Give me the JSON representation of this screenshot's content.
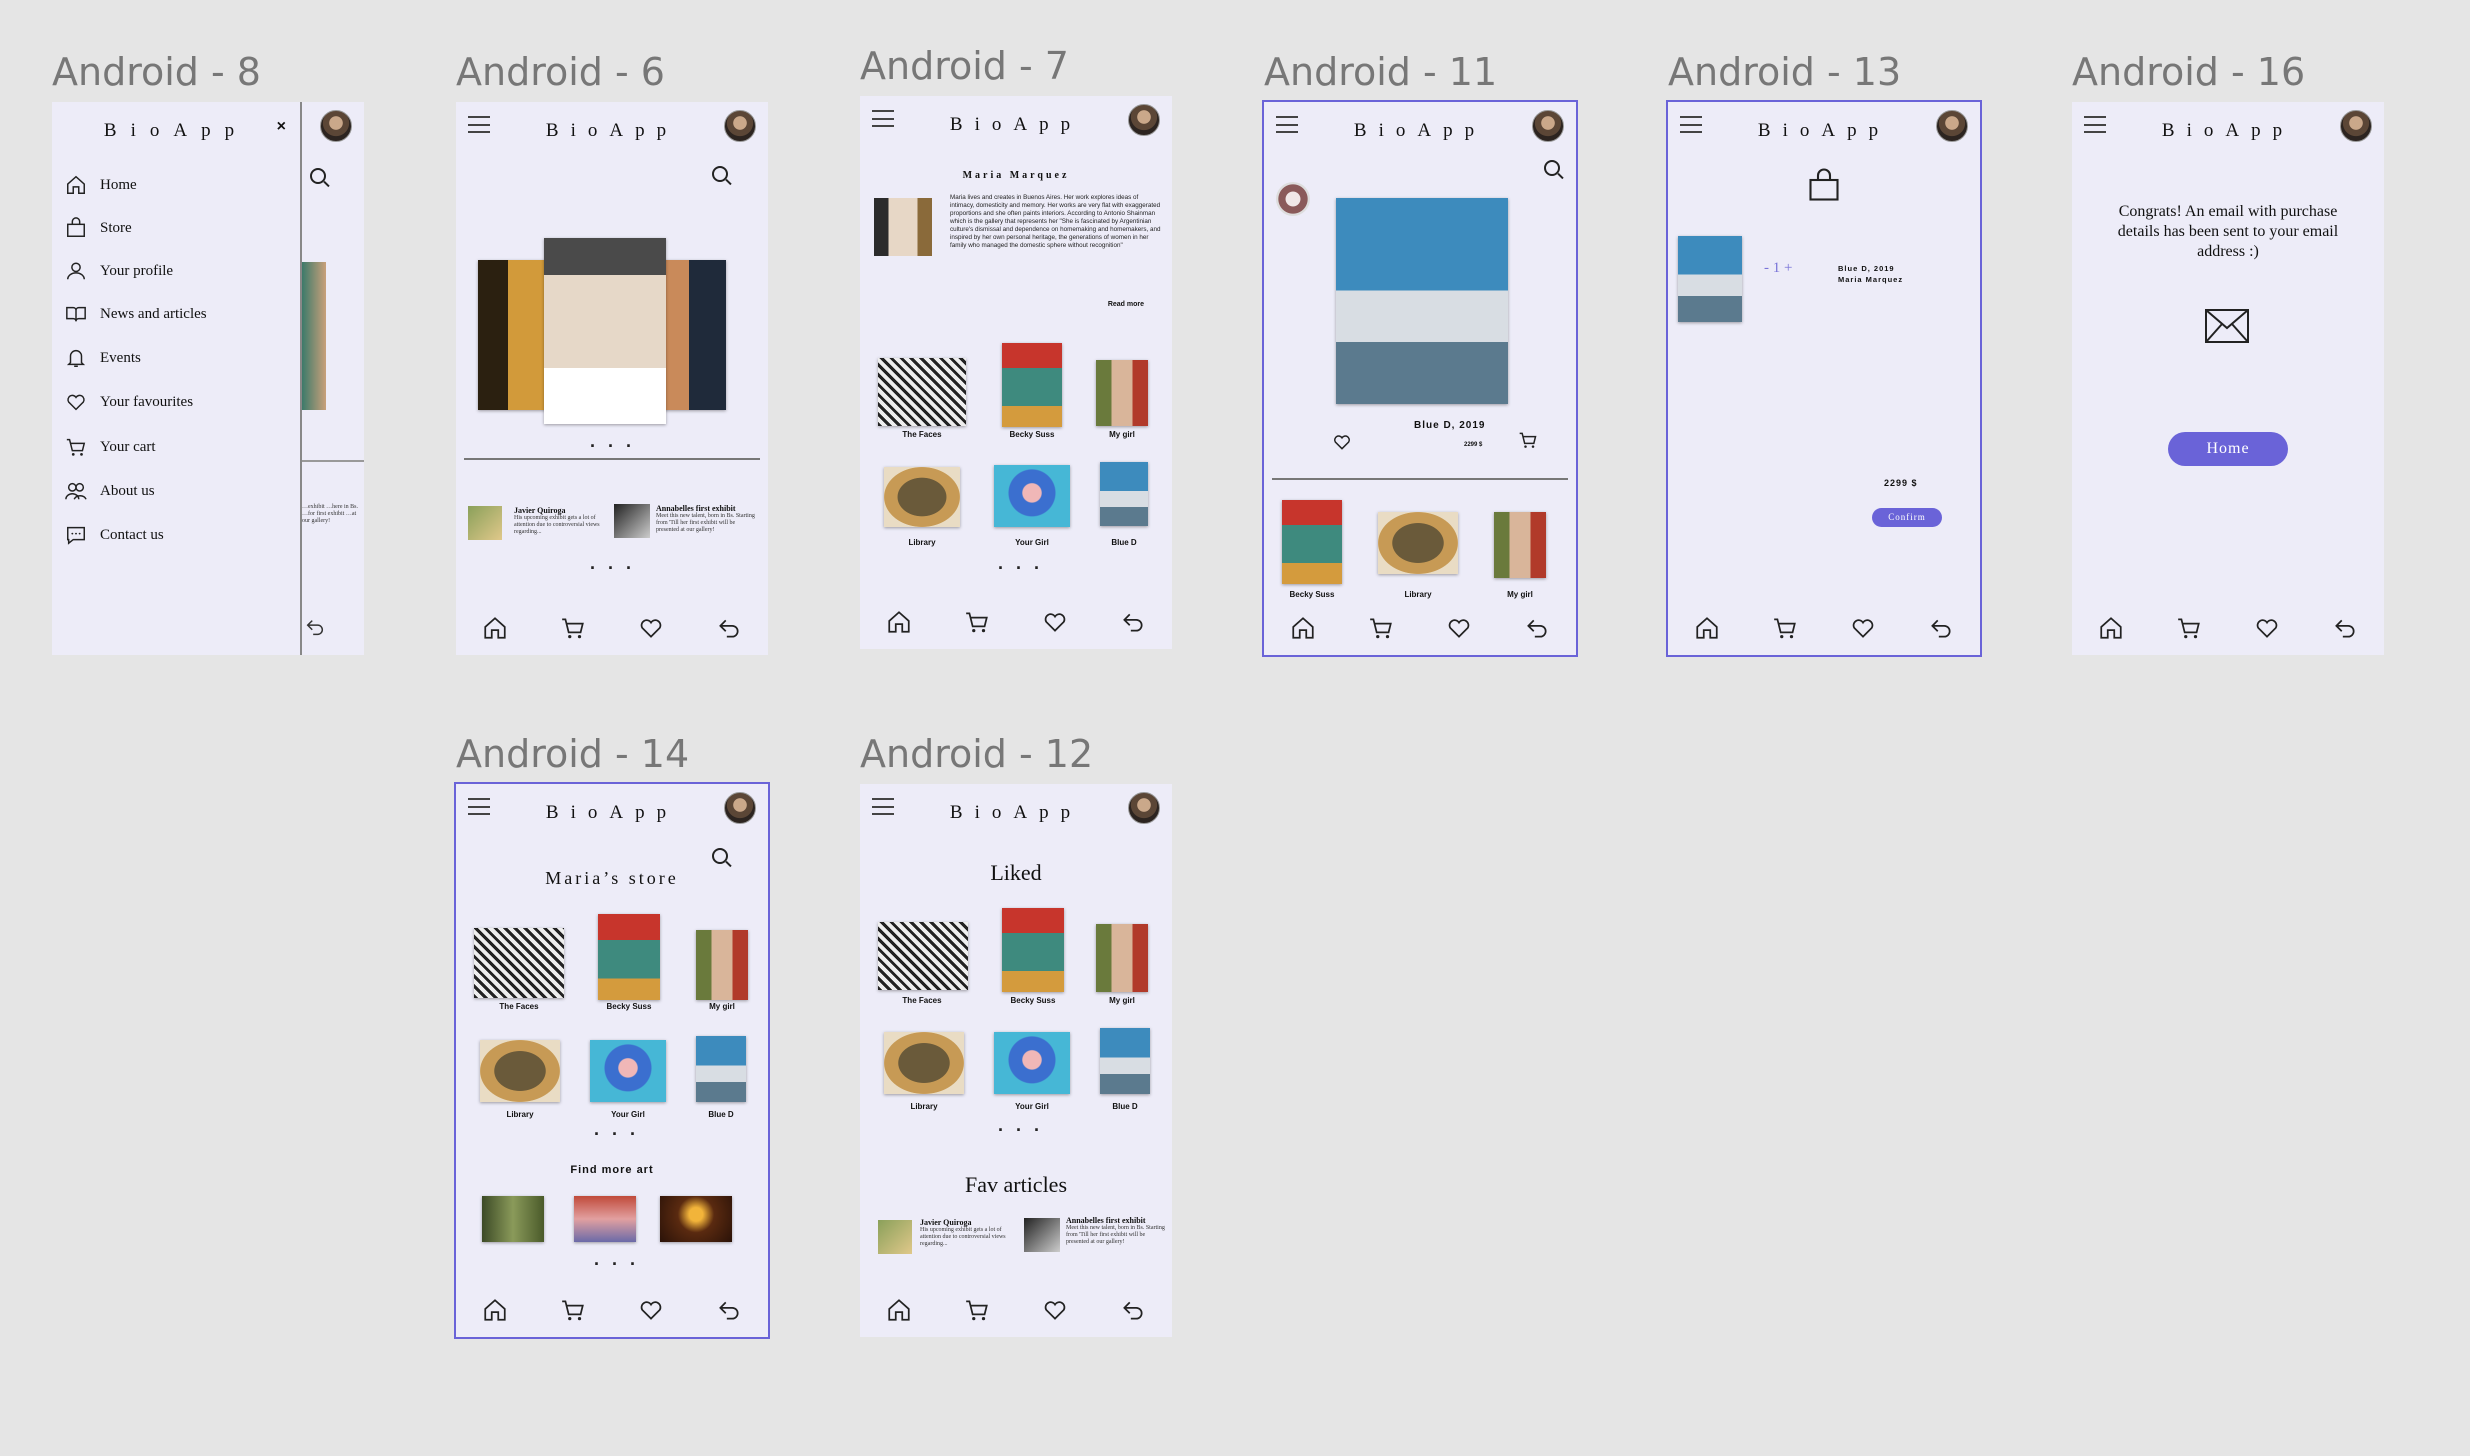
{
  "colors": {
    "canvas": "#e5e5e5",
    "frame_bg": "#edecf8",
    "accent": "#6a63d8",
    "selection": "#6a63d8"
  },
  "app": {
    "logo": "BioApp"
  },
  "frames": {
    "a8": {
      "label": "Android - 8",
      "close": "×",
      "menu": [
        "Home",
        "Store",
        "Your profile",
        "News and articles",
        "Events",
        "Your favourites",
        "Your cart",
        "About us",
        "Contact us"
      ],
      "peek_text": "…exhibit …here in Bs. …for first exhibit …at our gallery!"
    },
    "a6": {
      "label": "Android - 6",
      "article1": {
        "title": "Javier Quiroga",
        "text": "His upcoming exhibit gets a lot of attention due to controversial views regarding..."
      },
      "article2": {
        "title": "Annabelles first exhibit",
        "text": "Meet this new talent, born in Bs. Starting from 'Till her first exhibit will be presented at our gallery!"
      }
    },
    "a7": {
      "label": "Android - 7",
      "name": "Maria Marquez",
      "bio": "Maria lives and creates in Buenos Aires. Her work explores ideas of intimacy, domesticity and memory. Her works are very flat with exaggerated proportions and she often paints interiors. According to Antonio Shainman which is the gallery that represents her \"She is fascinated by Argentinian culture's dismissal and dependence on homemaking and homemakers, and inspired by her own personal heritage, the generations of women in her family who managed the domestic sphere without recognition\"",
      "read_more": "Read more"
    },
    "a11": {
      "label": "Android - 11",
      "title": "Blue D, 2019",
      "price": "2299 $"
    },
    "a13": {
      "label": "Android - 13",
      "qty": "- 1 +",
      "item_title": "Blue D, 2019",
      "item_artist": "Maria Marquez",
      "total": "2299 $",
      "confirm": "Confirm"
    },
    "a16": {
      "label": "Android - 16",
      "message": "Congrats! An email with purchase details has been sent to your email address :)",
      "home_button": "Home"
    },
    "a14": {
      "label": "Android - 14",
      "title": "Maria’s store",
      "find_more": "Find more art"
    },
    "a12": {
      "label": "Android - 12",
      "title": "Liked",
      "fav_articles": "Fav articles",
      "article1": {
        "title": "Javier Quiroga",
        "text": "His upcoming exhibit gets a lot of attention due to controversial views regarding..."
      },
      "article2": {
        "title": "Annabelles first exhibit",
        "text": "Meet this new talent, born in Bs. Starting from 'Till her first exhibit will be presented at our gallery!"
      }
    }
  },
  "artworks": [
    "The Faces",
    "Becky Suss",
    "My girl",
    "Library",
    "Your Girl",
    "Blue D"
  ],
  "dots": ". . ."
}
